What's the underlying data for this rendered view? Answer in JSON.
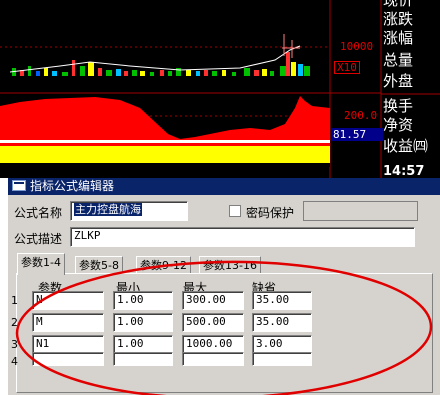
{
  "chart": {
    "side_labels": [
      "现价",
      "涨跌",
      "涨幅",
      "总量",
      "外盘",
      "换手",
      "净资",
      "收益㈣"
    ],
    "axis_upper": "10000",
    "axis_upper_box": "X10",
    "axis_lower": "200.0",
    "indicator_value": "81.57",
    "time": "14:57"
  },
  "dialog": {
    "title": "指标公式编辑器",
    "name_label": "公式名称",
    "name_value": "主力控盘航海",
    "password_label": "密码保护",
    "desc_label": "公式描述",
    "desc_value": "ZLKP"
  },
  "tabs": [
    "参数1-4",
    "参数5-8",
    "参数9-12",
    "参数13-16"
  ],
  "param_table": {
    "headers": [
      "参数",
      "最小",
      "最大",
      "缺省"
    ],
    "rows": [
      {
        "num": "1",
        "name": "N",
        "min": "1.00",
        "max": "300.00",
        "default": "35.00"
      },
      {
        "num": "2",
        "name": "M",
        "min": "1.00",
        "max": "500.00",
        "default": "35.00"
      },
      {
        "num": "3",
        "name": "N1",
        "min": "1.00",
        "max": "1000.00",
        "default": "3.00"
      },
      {
        "num": "4",
        "name": "",
        "min": "",
        "max": "",
        "default": ""
      }
    ]
  },
  "colors": {
    "chart_bg": "#000000",
    "volume_area": "#ff0000",
    "yellow_band": "#ffff00",
    "axis_red": "#e00000",
    "title_bar": "#0a246a",
    "annotation": "#e00000"
  }
}
